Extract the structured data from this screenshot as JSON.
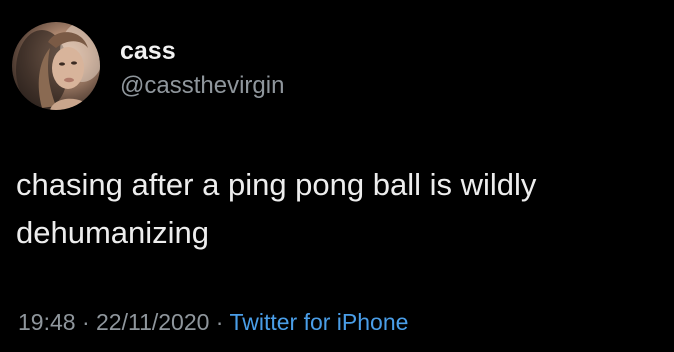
{
  "tweet": {
    "display_name": "cass",
    "handle": "@cassthevirgin",
    "text": "chasing after a ping pong ball is wildly dehumanizing",
    "time": "19:48",
    "separator_1": " · ",
    "date": "22/11/2020",
    "separator_2": " · ",
    "source": "Twitter for iPhone"
  },
  "colors": {
    "background": "#000000",
    "text": "#ededed",
    "muted": "#8f969c",
    "link": "#4a9ee8"
  },
  "icons": {
    "avatar": "profile-photo"
  }
}
